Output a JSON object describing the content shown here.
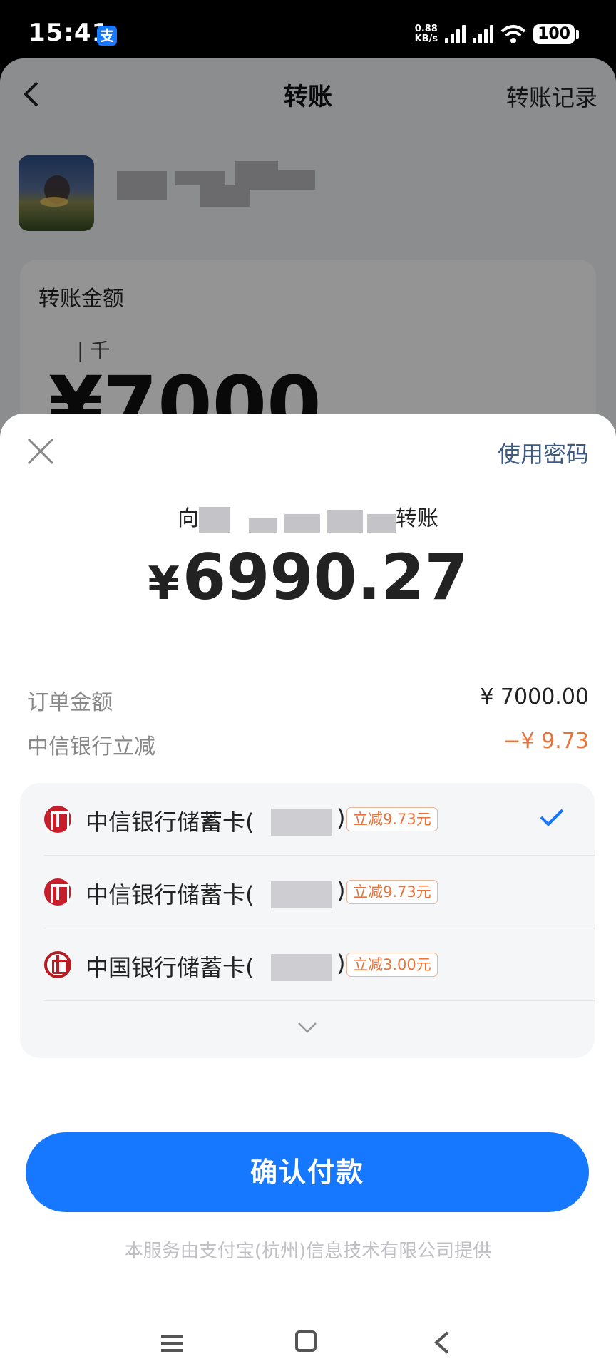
{
  "status_bar": {
    "time": "15:41",
    "app_icon": "支",
    "net_speed_value": "0.88",
    "net_speed_unit": "KB/s",
    "battery": "100"
  },
  "background_page": {
    "title": "转账",
    "record_link": "转账记录",
    "amount_label": "转账金额",
    "unit_hint": "| 千",
    "amount": "¥7000"
  },
  "sheet": {
    "use_password": "使用密码",
    "payee_prefix": "向",
    "payee_suffix": "转账",
    "currency_symbol": "¥",
    "pay_amount": "6990.27",
    "order_label": "订单金额",
    "order_value": "¥ 7000.00",
    "discount_label": "中信银行立减",
    "discount_value": "−¥ 9.73",
    "cards": [
      {
        "name": "中信银行储蓄卡(",
        "close": ")",
        "tag": "立减9.73元",
        "selected": true,
        "logo": "citic-bank-icon"
      },
      {
        "name": "中信银行储蓄卡(",
        "close": ")",
        "tag": "立减9.73元",
        "selected": false,
        "logo": "citic-bank-icon"
      },
      {
        "name": "中国银行储蓄卡(",
        "close": ")",
        "tag": "立减3.00元",
        "selected": false,
        "logo": "boc-bank-icon"
      }
    ],
    "confirm_button": "确认付款",
    "footer": "本服务由支付宝(杭州)信息技术有限公司提供"
  },
  "colors": {
    "primary": "#1677ff",
    "discount": "#e8733a",
    "link": "#3d5a80"
  }
}
